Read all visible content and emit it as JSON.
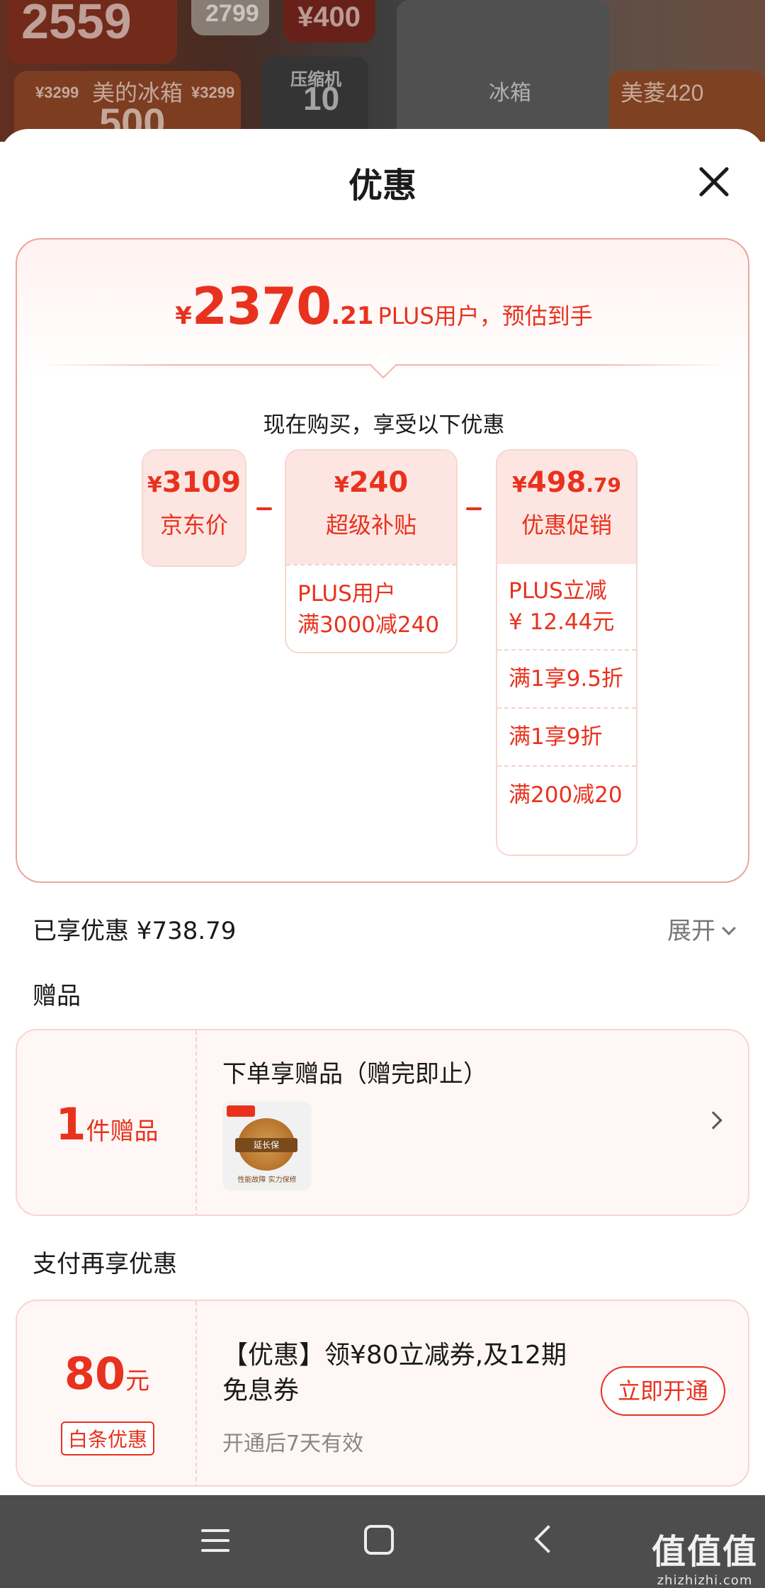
{
  "background": {
    "texts": [
      "2559",
      "2799",
      "¥400",
      "¥3299",
      "美的冰箱",
      "¥3299",
      "500",
      "压缩机",
      "10",
      "冰箱",
      "美菱420"
    ]
  },
  "sheet": {
    "title": "优惠",
    "close_icon": "close-icon"
  },
  "summary": {
    "yen": "¥",
    "price_int": "2370",
    "price_dec": ".21",
    "price_desc": "PLUS用户，预估到手",
    "subtitle": "现在购买，享受以下优惠",
    "columns": [
      {
        "yen": "¥",
        "amount": "3109",
        "dec": "",
        "label": "京东价",
        "rows": []
      },
      {
        "yen": "¥",
        "amount": "240",
        "dec": "",
        "label": "超级补贴",
        "rows": [
          "PLUS用户\n满3000减240"
        ]
      },
      {
        "yen": "¥",
        "amount": "498",
        "dec": ".79",
        "label": "优惠促销",
        "rows": [
          "PLUS立减\n¥ 12.44元",
          "满1享9.5折",
          "满1享9折",
          "满200减20"
        ]
      }
    ]
  },
  "enjoyed": {
    "label": "已享优惠 ¥738.79",
    "expand": "展开"
  },
  "gift": {
    "section_title": "赠品",
    "count": "1",
    "count_unit": "件赠品",
    "title": "下单享赠品（赠完即止）",
    "thumb_band": "延长保",
    "thumb_caption": "性能故障  实力保修"
  },
  "pay": {
    "section_title": "支付再享优惠",
    "value": "80",
    "unit": "元",
    "badge": "白条优惠",
    "title": "【优惠】领¥80立减券,及12期免息券",
    "subtitle": "开通后7天有效",
    "cta": "立即开通"
  },
  "navbar": {
    "icons": [
      "menu-icon",
      "home-icon",
      "back-icon"
    ]
  },
  "watermark": {
    "line1": "值值值",
    "line2": "zhizhizhi.com"
  },
  "colors": {
    "accent": "#e8321e",
    "card_border": "#f6d6d0",
    "navbar": "#4d4d4d"
  }
}
